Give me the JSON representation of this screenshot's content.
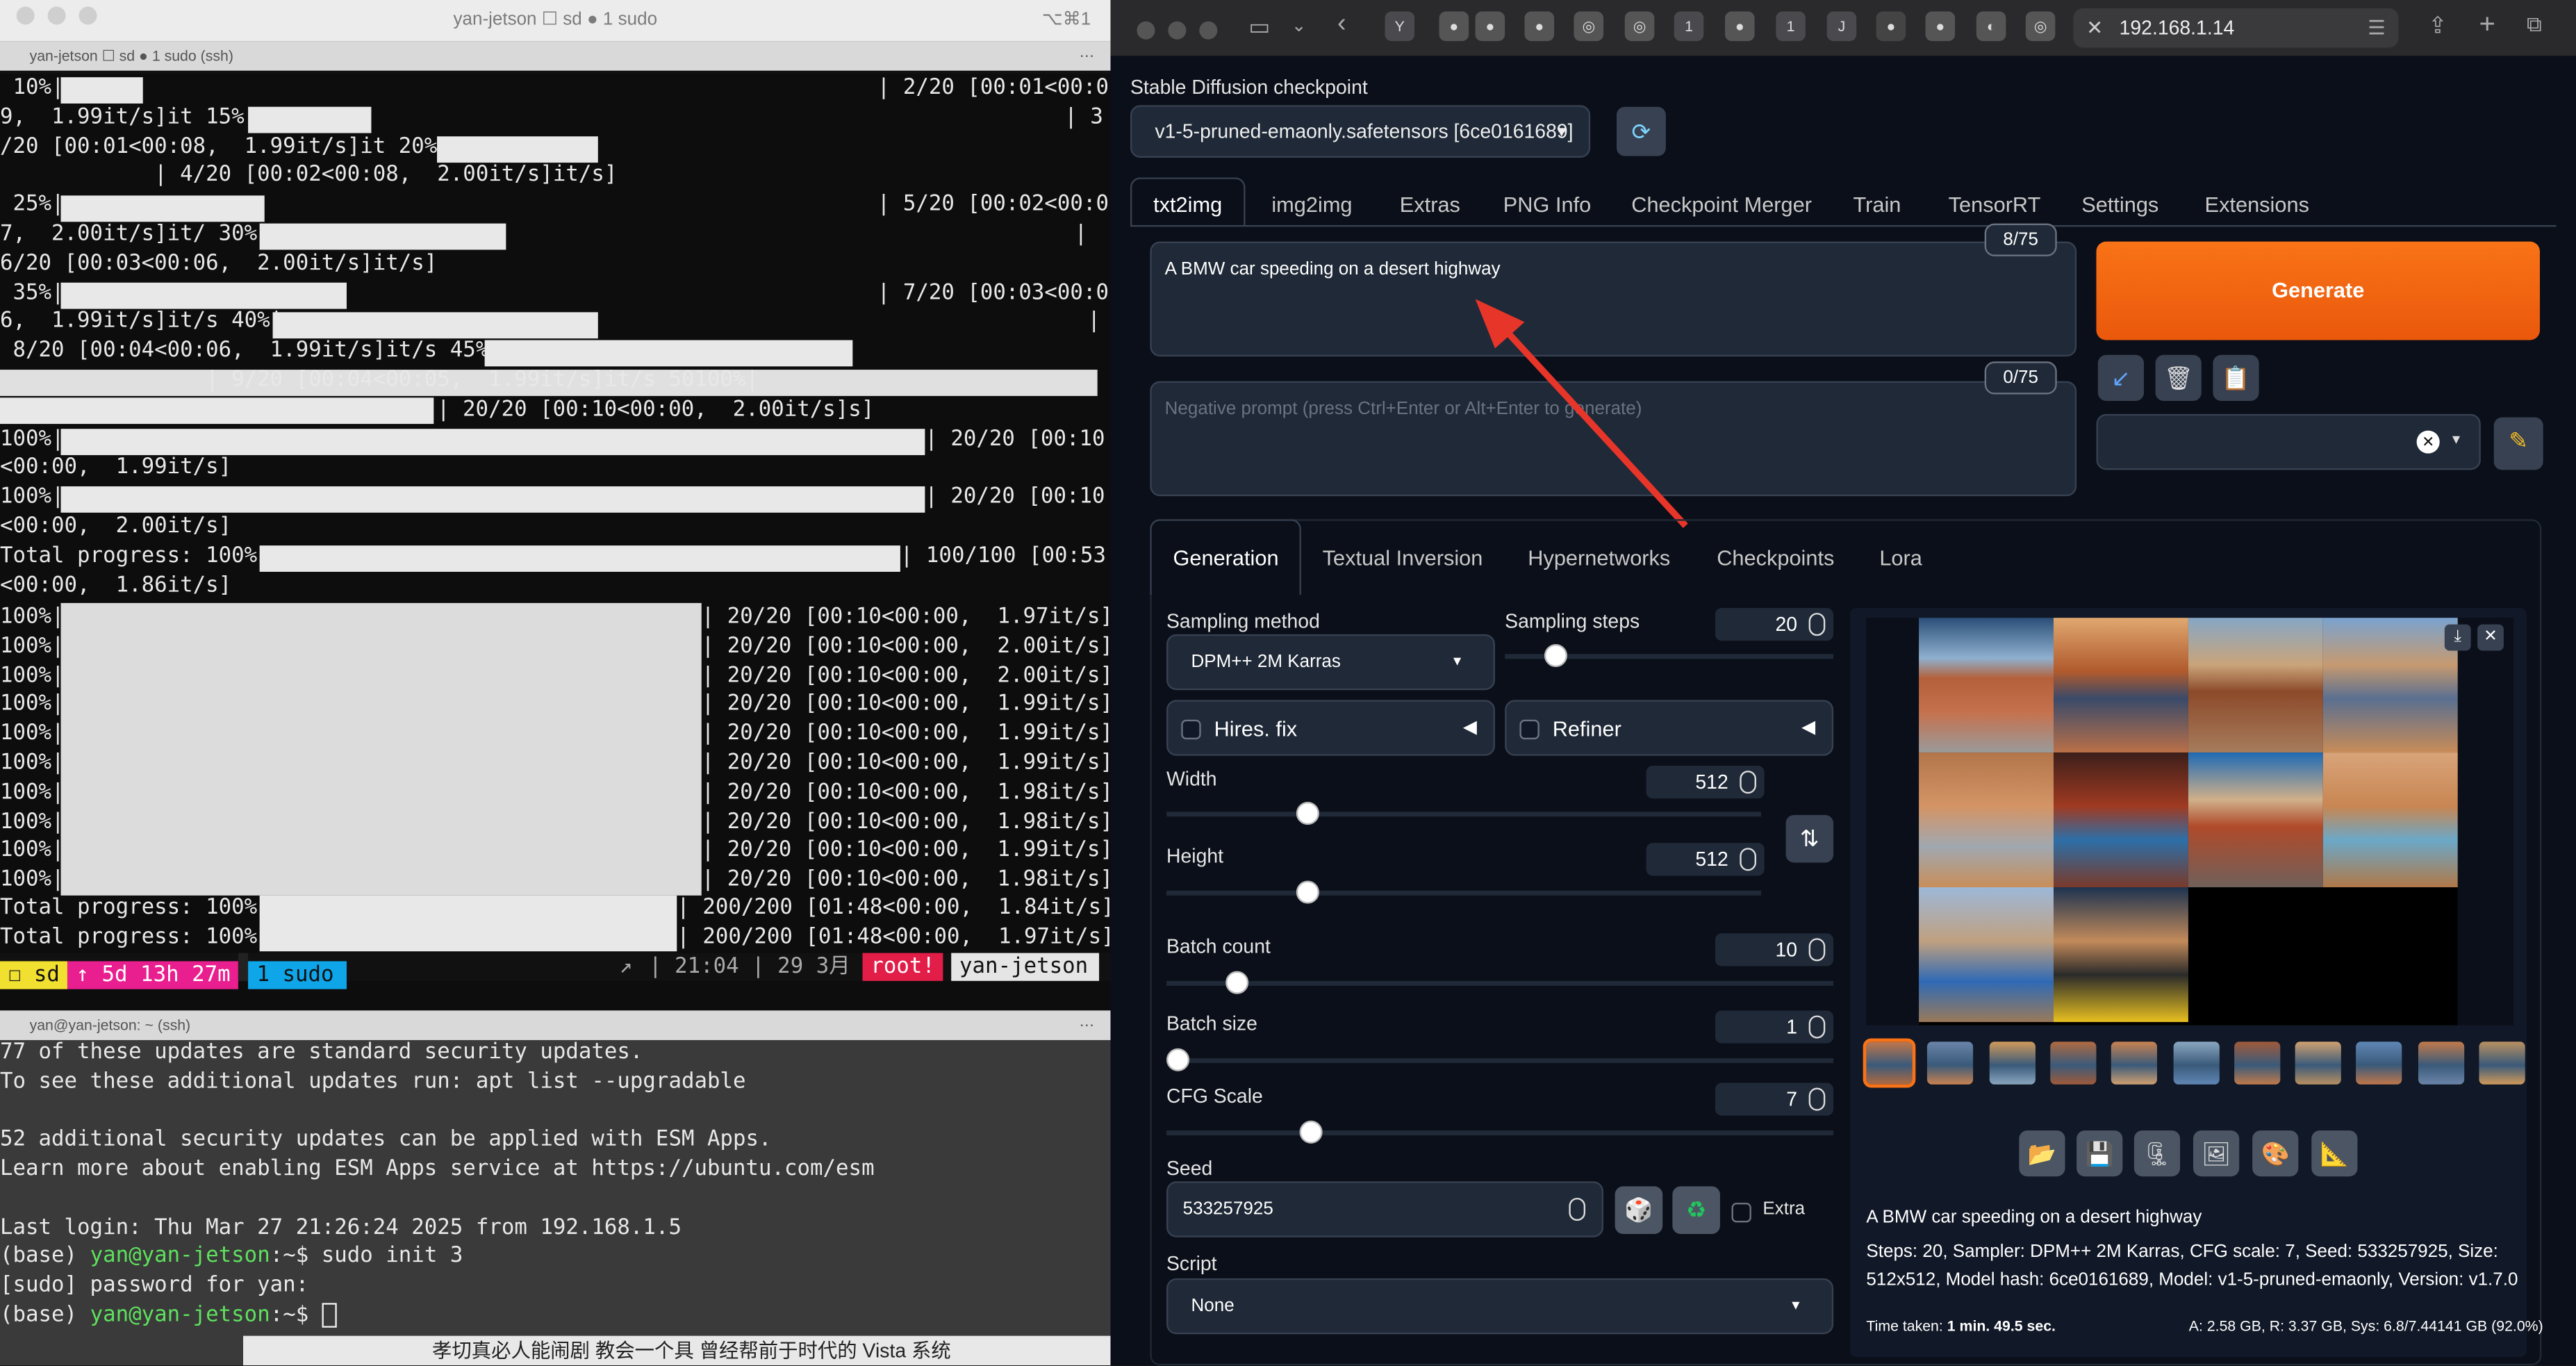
{
  "term1": {
    "title": "yan-jetson ☐ sd ● 1 sudo",
    "shortcut": "⌥⌘1",
    "tab": "yan-jetson ☐ sd ● 1 sudo (ssh)",
    "lines": [
      " 10%|",
      "9,  1.99it/s]it 15%|",
      "/20 [00:01<00:08,  1.99it/s]it 20%|",
      "            | 4/20 [00:02<00:08,  2.00it/s]it/s]",
      " 25%|",
      "7,  2.00it/s]it/ 30%|",
      "6/20 [00:03<00:06,  2.00it/s]it/s]",
      " 35%|",
      "6,  1.99it/s]it/s 40%|",
      " 8/20 [00:04<00:06,  1.99it/s]it/s 45%|",
      "                | 9/20 [00:04<00:05,  1.99it/s]it/s 50100%|",
      "",
      "100%|",
      "<00:00,  1.99it/s]",
      "100%|",
      "<00:00,  2.00it/s]",
      "Total progress: 100%|",
      "<00:00,  1.86it/s]"
    ],
    "right_lines": [
      "| 2/20 [00:01<00:0",
      "| 3",
      "",
      "",
      "| 5/20 [00:02<00:0",
      "|",
      "",
      "| 7/20 [00:03<00:0",
      "|",
      "",
      "",
      "| 20/20 [00:10<00:00,  2.00it/s]s]",
      "| 20/20 [00:10",
      "",
      "| 20/20 [00:10",
      "",
      "| 100/100 [00:53",
      ""
    ],
    "batch_lines": [
      "| 20/20 [00:10<00:00,  1.97it/s]",
      "| 20/20 [00:10<00:00,  2.00it/s]",
      "| 20/20 [00:10<00:00,  2.00it/s]",
      "| 20/20 [00:10<00:00,  1.99it/s]",
      "| 20/20 [00:10<00:00,  1.99it/s]",
      "| 20/20 [00:10<00:00,  1.99it/s]",
      "| 20/20 [00:10<00:00,  1.98it/s]",
      "| 20/20 [00:10<00:00,  1.98it/s]",
      "| 20/20 [00:10<00:00,  1.99it/s]",
      "| 20/20 [00:10<00:00,  1.98it/s]"
    ],
    "batch_prefix": "100%|",
    "total1": "Total progress: 100%|",
    "total1_right": "| 200/200 [01:48<00:00,  1.84it/s]",
    "total2": "Total progress: 100%|",
    "total2_right": "| 200/200 [01:48<00:00,  1.97it/s]",
    "status": {
      "sd": "☐ sd",
      "uptime": "↑ 5d 13h 27m",
      "sudo": "1 sudo",
      "arrow": "↗",
      "time": "| 21:04 | 29 3月",
      "root": "root!",
      "host": "yan-jetson"
    }
  },
  "term2": {
    "tab": "yan@yan-jetson: ~ (ssh)",
    "lines": [
      "77 of these updates are standard security updates.",
      "To see these additional updates run: apt list --upgradable",
      "",
      "52 additional security updates can be applied with ESM Apps.",
      "Learn more about enabling ESM Apps service at https://ubuntu.com/esm",
      "",
      "Last login: Thu Mar 27 21:26:24 2025 from 192.168.1.5"
    ],
    "cmd1_prefix": "(base) ",
    "cmd1_user": "yan@yan-jetson",
    "cmd1_rest": ":~$ sudo init 3",
    "sudo_line": "[sudo] password for yan:",
    "cmd2_prefix": "(base) ",
    "cmd2_user": "yan@yan-jetson",
    "cmd2_rest": ":~$ ",
    "behind_text": "孝切真必人能闹剧  教会一个具      曾经帮前于时代的 Vista 系统"
  },
  "browser": {
    "url": "192.168.1.14",
    "tab_labels": [
      "Y",
      "1",
      "1",
      "J"
    ]
  },
  "sd": {
    "checkpoint_label": "Stable Diffusion checkpoint",
    "checkpoint_value": "v1-5-pruned-emaonly.safetensors [6ce0161689]",
    "tabs": [
      "txt2img",
      "img2img",
      "Extras",
      "PNG Info",
      "Checkpoint Merger",
      "Train",
      "TensorRT",
      "Settings",
      "Extensions"
    ],
    "prompt": "A BMW car speeding on a desert highway",
    "prompt_count": "8/75",
    "neg_placeholder": "Negative prompt (press Ctrl+Enter or Alt+Enter to generate)",
    "neg_count": "0/75",
    "generate": "Generate",
    "subtabs": [
      "Generation",
      "Textual Inversion",
      "Hypernetworks",
      "Checkpoints",
      "Lora"
    ],
    "sampling_method_label": "Sampling method",
    "sampling_method": "DPM++ 2M Karras",
    "sampling_steps_label": "Sampling steps",
    "sampling_steps": "20",
    "hires": "Hires. fix",
    "refiner": "Refiner",
    "width_label": "Width",
    "width": "512",
    "height_label": "Height",
    "height": "512",
    "batch_count_label": "Batch count",
    "batch_count": "10",
    "batch_size_label": "Batch size",
    "batch_size": "1",
    "cfg_label": "CFG Scale",
    "cfg": "7",
    "seed_label": "Seed",
    "seed": "533257925",
    "extra": "Extra",
    "script_label": "Script",
    "script": "None",
    "info_prompt": "A BMW car speeding on a desert highway",
    "info_params": "Steps: 20, Sampler: DPM++ 2M Karras, CFG scale: 7, Seed: 533257925, Size: 512x512, Model hash: 6ce0161689, Model: v1-5-pruned-emaonly, Version: v1.7.0",
    "time_taken_label": "Time taken:",
    "time_taken": "1 min. 49.5 sec.",
    "mem": "A: 2.58 GB, R: 3.37 GB, Sys: 6.8/7.44141 GB (92.0%)",
    "colors": {
      "generate": "#f97316",
      "annotation_arrow": "#e8352a"
    }
  }
}
